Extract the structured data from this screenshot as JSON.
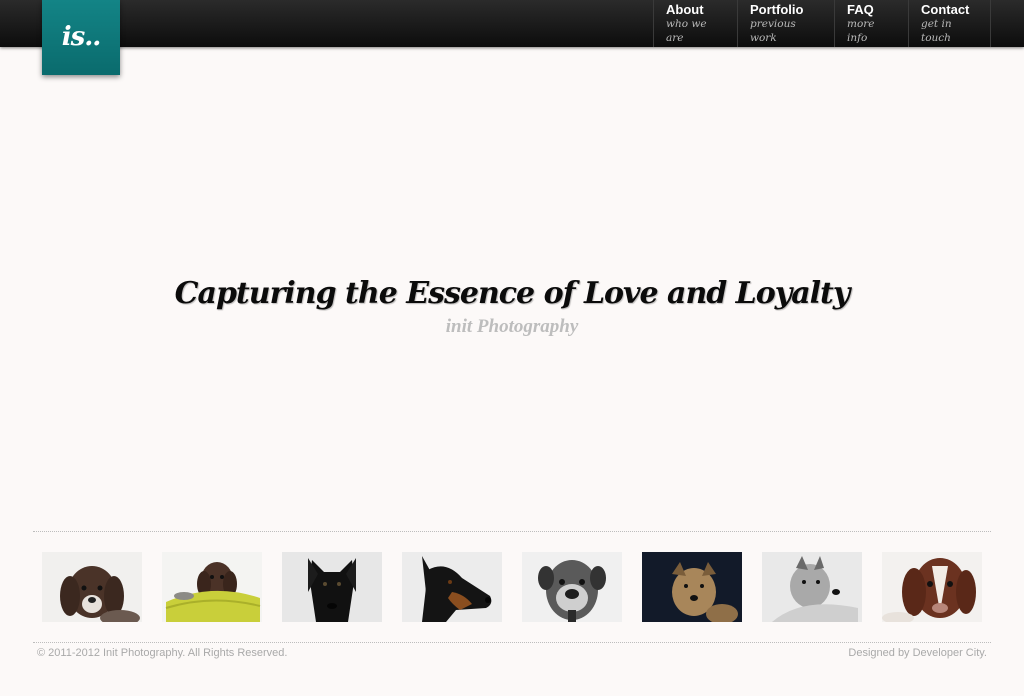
{
  "logo": {
    "text": "is.."
  },
  "nav": [
    {
      "label": "About",
      "sub": "who we are"
    },
    {
      "label": "Portfolio",
      "sub": "previous work"
    },
    {
      "label": "FAQ",
      "sub": "more info"
    },
    {
      "label": "Contact",
      "sub": "get in touch"
    }
  ],
  "hero": {
    "headline": "Capturing the Essence of Love and Loyalty",
    "subline": "init Photography"
  },
  "gallery": [
    {
      "icon": "spaniel-puppy-photo"
    },
    {
      "icon": "puppy-in-basket-photo"
    },
    {
      "icon": "black-dog-photo"
    },
    {
      "icon": "doberman-photo"
    },
    {
      "icon": "boxer-bw-photo"
    },
    {
      "icon": "terrier-dark-photo"
    },
    {
      "icon": "terrier-bw-photo"
    },
    {
      "icon": "springer-spaniel-photo"
    }
  ],
  "footer": {
    "copyright": "© 2011-2012 Init Photography. All Rights Reserved.",
    "credit": "Designed by Developer City."
  },
  "colors": {
    "accent": "#0f7a7c",
    "topbar": "#1a1a1a",
    "background": "#fcf9f8"
  }
}
